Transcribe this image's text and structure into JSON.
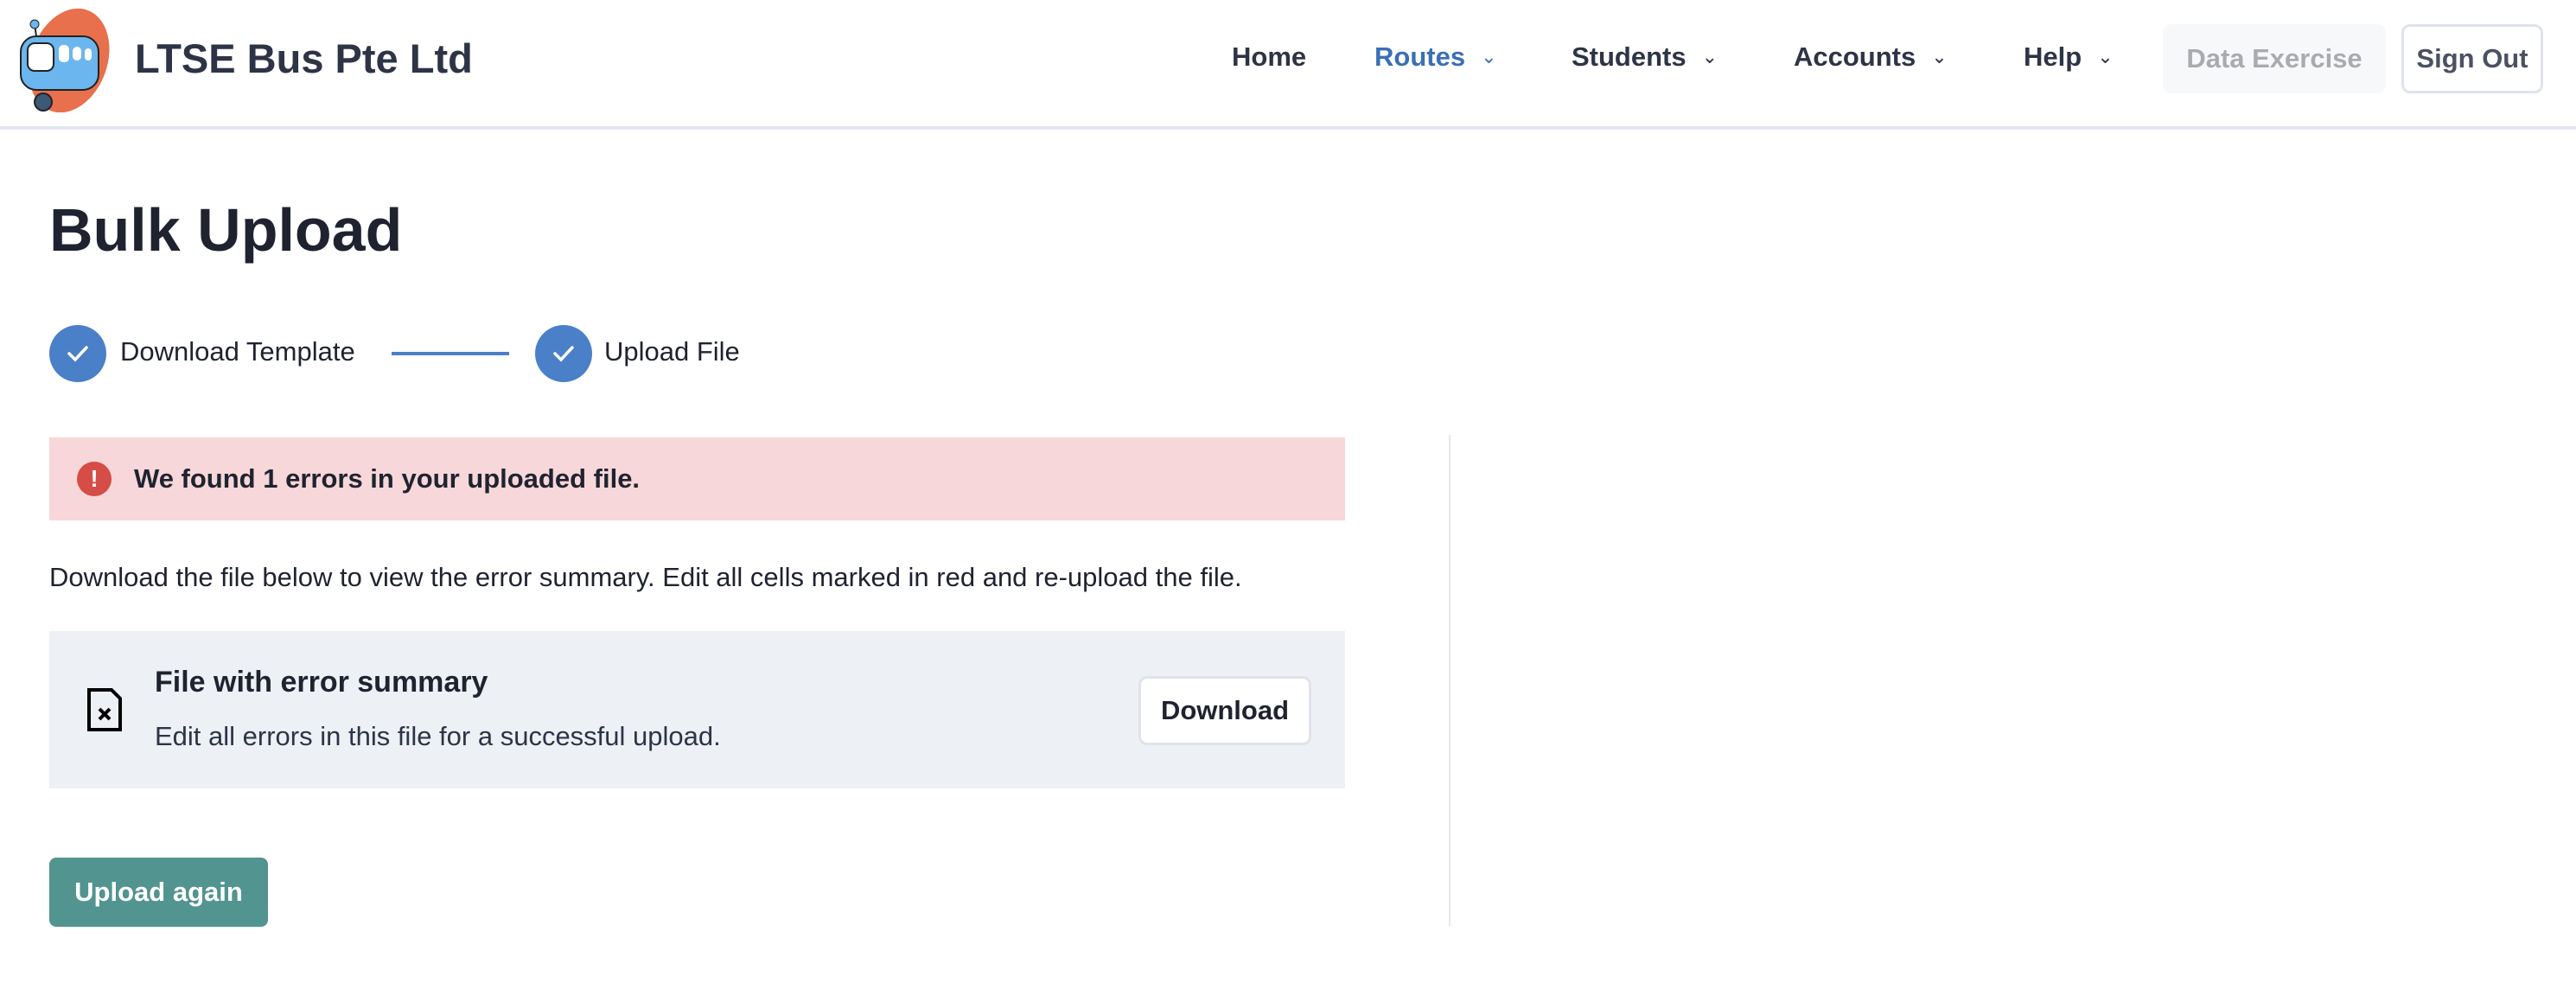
{
  "header": {
    "brand": "LTSE Bus Pte Ltd",
    "logo_icon": "bus-mascot-logo",
    "nav": [
      {
        "label": "Home",
        "dropdown": false,
        "active": false
      },
      {
        "label": "Routes",
        "dropdown": true,
        "active": true
      },
      {
        "label": "Students",
        "dropdown": true,
        "active": false
      },
      {
        "label": "Accounts",
        "dropdown": true,
        "active": false
      },
      {
        "label": "Help",
        "dropdown": true,
        "active": false
      }
    ],
    "chevron": "⌄",
    "data_exercise": "Data Exercise",
    "sign_out": "Sign Out"
  },
  "page": {
    "title": "Bulk Upload",
    "steps": [
      {
        "label": "Download Template",
        "done": true
      },
      {
        "label": "Upload File",
        "done": true
      }
    ],
    "error_banner": {
      "icon": "!",
      "text": "We found 1 errors in your uploaded file."
    },
    "description": "Download the file below to view the error summary. Edit all cells marked in red and re-upload the file.",
    "file_card": {
      "title": "File with error summary",
      "subtitle": "Edit all errors in this file for a successful upload.",
      "download": "Download"
    },
    "upload_again": "Upload again"
  },
  "colors": {
    "accent": "#4a80c8",
    "active_nav": "#3a6fb5",
    "error": "#d64c46",
    "error_bg": "#f7d7d9",
    "primary_button": "#52948f"
  }
}
